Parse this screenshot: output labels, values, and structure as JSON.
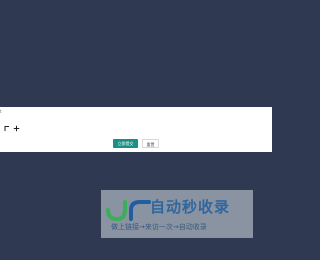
{
  "dialog": {
    "corner_mark": "t",
    "buttons": {
      "primary_label": "立即提交",
      "secondary_label": "重置"
    },
    "icons": [
      "corner-arrow-icon",
      "plus-icon"
    ]
  },
  "watermark": {
    "title": "自动秒收录",
    "subtitle": "做上链接→来访一次→自动收录",
    "logo_text": "JR"
  },
  "colors": {
    "background": "#2f3a52",
    "primary": "#1a8f86",
    "watermark_blue": "#1f5fa0",
    "watermark_green": "#3cae5a"
  }
}
